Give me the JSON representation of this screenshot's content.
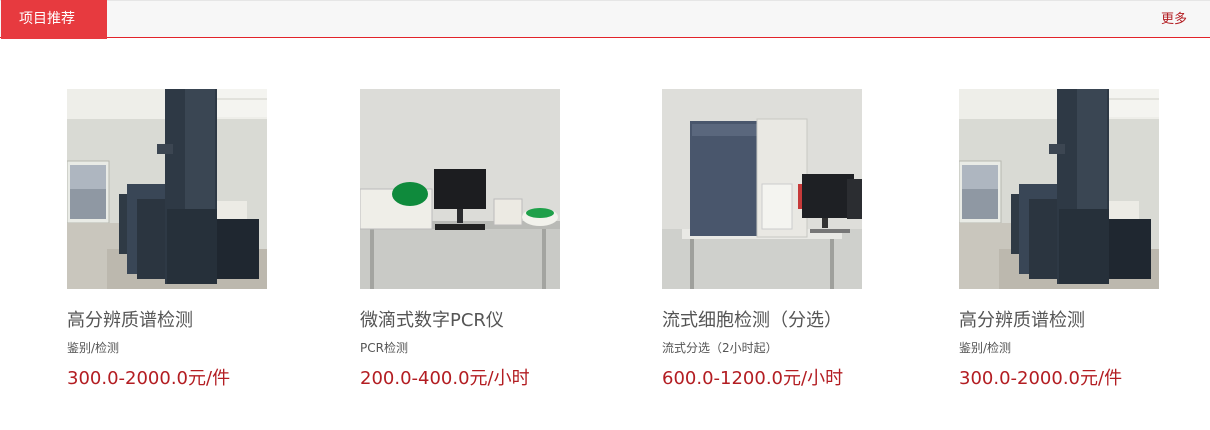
{
  "header": {
    "tab_label": "项目推荐",
    "more_label": "更多"
  },
  "cards": [
    {
      "image_icon": "mass-spectrometer-photo",
      "title": "高分辨质谱检测",
      "subtitle": "鉴别/检测",
      "price": "300.0-2000.0元/件"
    },
    {
      "image_icon": "digital-pcr-instrument-photo",
      "title": "微滴式数字PCR仪",
      "subtitle": "PCR检测",
      "price": "200.0-400.0元/小时"
    },
    {
      "image_icon": "flow-cytometer-photo",
      "title": "流式细胞检测（分选）",
      "subtitle": "流式分选（2小时起）",
      "price": "600.0-1200.0元/小时"
    },
    {
      "image_icon": "mass-spectrometer-photo",
      "title": "高分辨质谱检测",
      "subtitle": "鉴别/检测",
      "price": "300.0-2000.0元/件"
    }
  ],
  "colors": {
    "accent": "#e73a3f",
    "price": "#b31d22",
    "text": "#555555"
  }
}
